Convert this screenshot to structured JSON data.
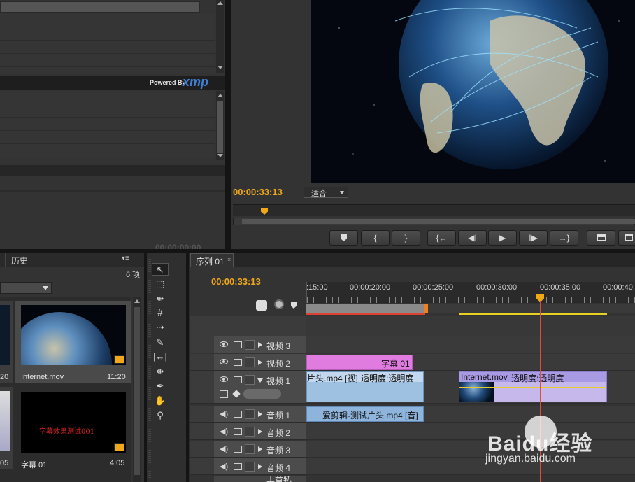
{
  "metadata_panel": {
    "powered_by": "Powered By",
    "xmp_logo": "xmp",
    "timecode_faded": "00:00:00:00"
  },
  "program_monitor": {
    "timecode": "00:00:33:13",
    "fit_select": "适合",
    "transport_icons": [
      "marker-icon",
      "in-point-icon",
      "out-point-icon",
      "go-to-in-icon",
      "step-back-icon",
      "play-icon",
      "step-forward-icon",
      "go-to-out-icon",
      "lift-icon",
      "extract-icon"
    ]
  },
  "project_panel": {
    "history_tab": "历史",
    "item_count": "6 项",
    "items": [
      {
        "name": "Internet.mov",
        "duration": "11:20"
      },
      {
        "name": "字幕 01",
        "duration": "4:05",
        "thumb_text": "字幕效果测试001"
      }
    ],
    "left_cut_durations": [
      "20",
      "05"
    ]
  },
  "tools": [
    "selection-tool-icon",
    "track-select-tool-icon",
    "ripple-edit-tool-icon",
    "rolling-edit-tool-icon",
    "rate-stretch-tool-icon",
    "razor-tool-icon",
    "slip-tool-icon",
    "slide-tool-icon",
    "pen-tool-icon",
    "hand-tool-icon",
    "zoom-tool-icon"
  ],
  "timeline": {
    "tab_label": "序列 01",
    "timecode": "00:00:33:13",
    "ruler_labels": [
      ":15:00",
      "00:00:20:00",
      "00:00:25:00",
      "00:00:30:00",
      "00:00:35:00",
      "00:00:40:00"
    ],
    "tracks": [
      {
        "name": "视频 3",
        "kind": "video"
      },
      {
        "name": "视频 2",
        "kind": "video"
      },
      {
        "name": "视频 1",
        "kind": "video"
      },
      {
        "name": "音频 1",
        "kind": "audio"
      },
      {
        "name": "音频 2",
        "kind": "audio"
      },
      {
        "name": "音频 3",
        "kind": "audio"
      },
      {
        "name": "音频 4",
        "kind": "audio"
      }
    ],
    "master_track_label": "主音轨",
    "clips": {
      "title_clip": "字幕 01",
      "video1_clip_a": "片头.mp4 [视]",
      "video1_clip_a_fx": "透明度:透明度",
      "video1_clip_b": "Internet.mov",
      "video1_clip_b_fx": "透明度:透明度",
      "audio1_clip": "爱剪辑-测试片头.mp4 [音]"
    }
  },
  "watermark": {
    "brand": "Baidu经验",
    "url": "jingyan.baidu.com"
  },
  "colors": {
    "timecode": "#f0a818",
    "title_clip": "#e07be0",
    "video_clip": "#9ec1e2",
    "video_clip_b": "#c7b8ec",
    "audio_clip": "#8eb4dc",
    "playhead": "#e44a3a"
  }
}
